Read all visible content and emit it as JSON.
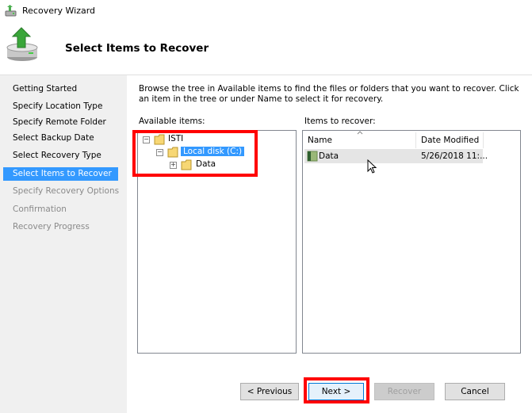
{
  "window": {
    "title": "Recovery Wizard"
  },
  "header": {
    "title": "Select Items to Recover"
  },
  "steps": [
    {
      "label": "Getting Started",
      "state": "normal"
    },
    {
      "label": "Specify Location Type",
      "state": "normal"
    },
    {
      "label": "Specify Remote Folder",
      "state": "normal"
    },
    {
      "label": "Select Backup Date",
      "state": "normal"
    },
    {
      "label": "Select Recovery Type",
      "state": "normal"
    },
    {
      "label": "Select Items to Recover",
      "state": "active"
    },
    {
      "label": "Specify Recovery Options",
      "state": "disabled"
    },
    {
      "label": "Confirmation",
      "state": "disabled"
    },
    {
      "label": "Recovery Progress",
      "state": "disabled"
    }
  ],
  "main": {
    "description": "Browse the tree in Available items to find the files or folders that you want to recover. Click an item in the tree or under Name to select it for recovery.",
    "available_label": "Available items:",
    "recover_label": "Items to recover:",
    "tree": [
      {
        "label": "ISTI",
        "expander": "−"
      },
      {
        "label": "Local disk (C:)",
        "expander": "−",
        "selected": true
      },
      {
        "label": "Data",
        "expander": "+"
      }
    ],
    "columns": {
      "name": "Name",
      "date": "Date Modified"
    },
    "rows": [
      {
        "name": "Data",
        "date": "5/26/2018 11:..."
      }
    ]
  },
  "buttons": {
    "previous": "< Previous",
    "next": "Next >",
    "recover": "Recover",
    "cancel": "Cancel"
  },
  "colors": {
    "highlight": "#3399ff",
    "annotation": "#ff0000"
  }
}
